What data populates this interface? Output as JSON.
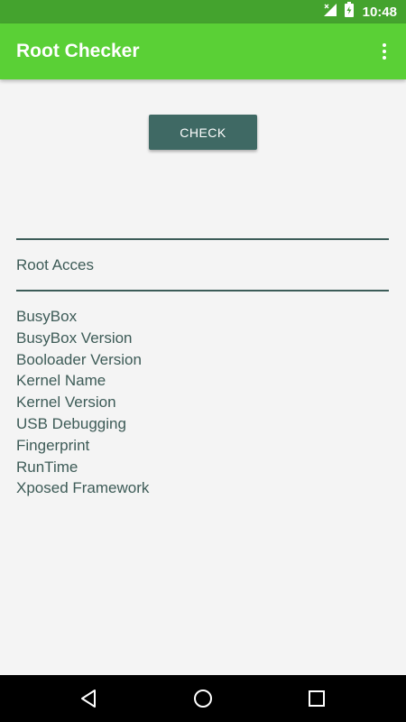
{
  "status_bar": {
    "time": "10:48",
    "icons": [
      "no-signal-icon",
      "battery-charging-icon"
    ]
  },
  "app_bar": {
    "title": "Root Checker",
    "menu_icon": "more-vert-icon"
  },
  "main": {
    "check_button_label": "CHECK",
    "root_access_label": "Root Acces",
    "info_items": [
      "BusyBox",
      "BusyBox Version",
      "Booloader Version",
      "Kernel Name",
      "Kernel Version",
      "USB Debugging",
      "Fingerprint",
      "RunTime",
      "Xposed Framework"
    ]
  },
  "nav_bar": {
    "icons": [
      "back-icon",
      "home-icon",
      "recents-icon"
    ]
  },
  "colors": {
    "status_bar": "#44a32e",
    "app_bar": "#5ad036",
    "button": "#3f6964",
    "text": "#3d5b57",
    "background": "#f4f4f4"
  }
}
